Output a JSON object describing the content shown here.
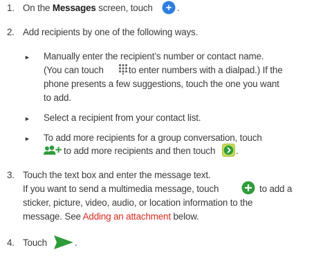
{
  "steps": [
    {
      "number": "1.",
      "pre": "On the ",
      "bold": "Messages",
      "post": " screen, touch ",
      "end": ".",
      "icon": "new-message-icon"
    },
    {
      "number": "2.",
      "text": "Add recipients by one of the following ways.",
      "sub": [
        {
          "lines": [
            "Manually enter the recipient’s number or contact name.",
            "(You can touch ",
            " to enter numbers with a dialpad.) If the",
            "phone presents a few suggestions, touch the one you want",
            "to add."
          ],
          "icon": "dialpad-icon"
        },
        {
          "lines": [
            "Select a recipient from your contact list."
          ]
        },
        {
          "lines": [
            "To add more recipients for a group conversation, touch",
            " to add more recipients and then touch ",
            "."
          ],
          "icons": [
            "add-people-icon",
            "next-arrow-icon"
          ]
        }
      ]
    },
    {
      "number": "3.",
      "text": "Touch the text box and enter the message text.",
      "para": [
        "If you want to send a multimedia message, touch ",
        " to add a",
        "sticker, picture, video, audio, or location information to the",
        "message. See ",
        "Adding an attachment",
        " below."
      ],
      "icon": "add-attachment-icon"
    },
    {
      "number": "4.",
      "text": "Touch ",
      "end": ".",
      "icon": "send-icon"
    }
  ],
  "colors": {
    "text": "#3a3a3a",
    "link": "#d42a1f",
    "icon_blue": "#2f7fe0",
    "icon_green": "#2e9c3a",
    "icon_gray": "#6a6a6a"
  }
}
